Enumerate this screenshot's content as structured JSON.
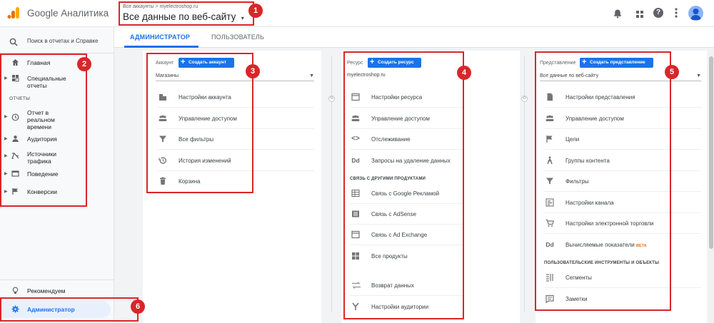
{
  "app": {
    "name": "Google Аналитика"
  },
  "header": {
    "breadcrumb": "Все аккаунты > myelectroshop.ru",
    "view_selector": "Все данные по веб-сайту",
    "icons": [
      "bell-icon",
      "apps-grid-icon",
      "help-icon",
      "more-vert-icon",
      "avatar-icon"
    ]
  },
  "search": {
    "placeholder": "Поиск в отчетах и Справке"
  },
  "sidebar": {
    "items": [
      {
        "label": "Главная",
        "icon": "home-icon"
      },
      {
        "label": "Специальные отчеты",
        "icon": "custom-reports-icon"
      }
    ],
    "section_label": "ОТЧЕТЫ",
    "reports": [
      {
        "label": "Отчет в реальном времени",
        "icon": "clock-icon"
      },
      {
        "label": "Аудитория",
        "icon": "person-icon"
      },
      {
        "label": "Источники трафика",
        "icon": "acquisition-icon"
      },
      {
        "label": "Поведение",
        "icon": "behavior-icon"
      },
      {
        "label": "Конверсии",
        "icon": "flag-icon"
      }
    ],
    "recommended": "Рекомендуем",
    "admin": "Администратор"
  },
  "tabs": {
    "admin": "АДМИНИСТРАТОР",
    "user": "ПОЛЬЗОВАТЕЛЬ"
  },
  "account": {
    "header": "Аккаунт",
    "create": "Создать аккаунт",
    "selected": "Магазины",
    "items": [
      {
        "label": "Настройки аккаунта",
        "icon": "building-icon"
      },
      {
        "label": "Управление доступом",
        "icon": "people-icon"
      },
      {
        "label": "Все фильтры",
        "icon": "filter-icon"
      },
      {
        "label": "История изменений",
        "icon": "history-icon"
      },
      {
        "label": "Корзина",
        "icon": "trash-icon"
      }
    ]
  },
  "property": {
    "header": "Ресурс",
    "create": "Создать ресурс",
    "selected": "myelectroshop.ru",
    "items": [
      {
        "label": "Настройки ресурса",
        "icon": "window-icon"
      },
      {
        "label": "Управление доступом",
        "icon": "people-icon"
      },
      {
        "label": "Отслеживание",
        "icon": "code-icon"
      },
      {
        "label": "Запросы на удаление данных",
        "icon": "dd-icon"
      }
    ],
    "section": "СВЯЗЬ С ДРУГИМИ ПРОДУКТАМИ",
    "links": [
      {
        "label": "Связь с Google Рекламой",
        "icon": "table-icon"
      },
      {
        "label": "Связь с AdSense",
        "icon": "list-box-icon"
      },
      {
        "label": "Связь с Ad Exchange",
        "icon": "window-icon"
      },
      {
        "label": "Все продукты",
        "icon": "grid-icon"
      },
      {
        "label": "Возврат данных",
        "icon": "swap-icon"
      },
      {
        "label": "Настройки аудитории",
        "icon": "fork-icon"
      }
    ]
  },
  "view": {
    "header": "Представление",
    "create": "Создать представление",
    "selected": "Все данные по веб-сайту",
    "items": [
      {
        "label": "Настройки представления",
        "icon": "document-icon"
      },
      {
        "label": "Управление доступом",
        "icon": "people-icon"
      },
      {
        "label": "Цели",
        "icon": "flag-icon"
      },
      {
        "label": "Группы контента",
        "icon": "person-walk-icon"
      },
      {
        "label": "Фильтры",
        "icon": "filter-icon"
      },
      {
        "label": "Настройки канала",
        "icon": "channel-icon"
      },
      {
        "label": "Настройки электронной торговли",
        "icon": "cart-icon"
      },
      {
        "label": "Вычисляемые показатели",
        "icon": "dd-icon",
        "badge": "BETA"
      }
    ],
    "section": "ПОЛЬЗОВАТЕЛЬСКИЕ ИНСТРУМЕНТЫ И ОБЪЕКТЫ",
    "tools": [
      {
        "label": "Сегменты",
        "icon": "segments-icon"
      },
      {
        "label": "Заметки",
        "icon": "note-icon"
      }
    ]
  },
  "annotations": [
    "1",
    "2",
    "3",
    "4",
    "5",
    "6"
  ],
  "colors": {
    "accent": "#1a73e8",
    "annotation": "#d9262a",
    "logo_orange": "#f9ab00",
    "logo_dark": "#e37400"
  }
}
